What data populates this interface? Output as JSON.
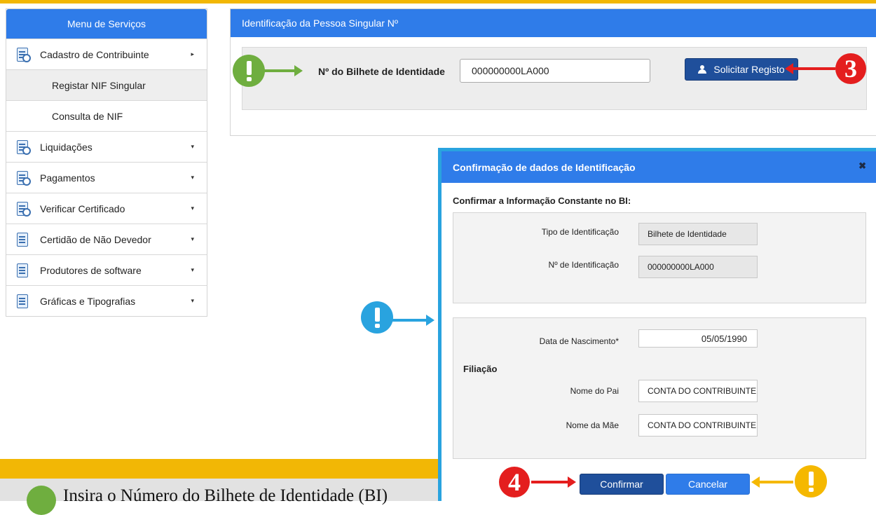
{
  "sidebar": {
    "header": "Menu de Serviços",
    "items": [
      {
        "label": "Cadastro de Contribuinte",
        "icon": "document-search-icon",
        "caret": "▸"
      },
      {
        "label": "Registar NIF Singular",
        "sub": true,
        "active": true
      },
      {
        "label": "Consulta de NIF",
        "sub": true
      },
      {
        "label": "Liquidações",
        "icon": "document-search-icon",
        "caret": "▾"
      },
      {
        "label": "Pagamentos",
        "icon": "document-search-icon",
        "caret": "▾"
      },
      {
        "label": "Verificar Certificado",
        "icon": "certificate-icon",
        "caret": "▾"
      },
      {
        "label": "Certidão de Não Devedor",
        "icon": "checked-document-icon",
        "caret": "▾"
      },
      {
        "label": "Produtores de software",
        "icon": "spreadsheet-icon",
        "caret": "▾"
      },
      {
        "label": "Gráficas e Tipografias",
        "icon": "printing-document-icon",
        "caret": "▾"
      }
    ]
  },
  "main": {
    "title": "Identificação da Pessoa Singular Nº",
    "bi_label": "Nº do Bilhete de Identidade",
    "bi_value": "000000000LA000",
    "solicitar_button": "Solicitar Registo"
  },
  "modal": {
    "title": "Confirmação de dados de Identificação",
    "close": "✖",
    "confirm_text": "Confirmar a Informação Constante no BI:",
    "tipo_label": "Tipo de Identificação",
    "tipo_value": "Bilhete de Identidade",
    "num_label": "Nº de Identificação",
    "num_value": "000000000LA000",
    "nascimento_label": "Data de Nascimento*",
    "nascimento_value": "05/05/1990",
    "filiacao_label": "Filiação",
    "pai_label": "Nome do Pai",
    "pai_value": "CONTA DO CONTRIBUINTE",
    "mae_label": "Nome da Mãe",
    "mae_value": "CONTA DO CONTRIBUINTE",
    "confirmar_button": "Confirmar",
    "cancelar_button": "Cancelar"
  },
  "callouts": {
    "step3": "3",
    "step4": "4",
    "colors": {
      "green": "#6fae3f",
      "blue": "#29a3df",
      "red": "#e41e1e",
      "yellow": "#f5b800"
    }
  },
  "footer": {
    "partial_text": "Insira o Número do Bilhete de Identidade (BI)"
  },
  "colors": {
    "primary": "#2f7ce9",
    "dark_button": "#1f4f9b",
    "accent_bar": "#f2b705"
  }
}
